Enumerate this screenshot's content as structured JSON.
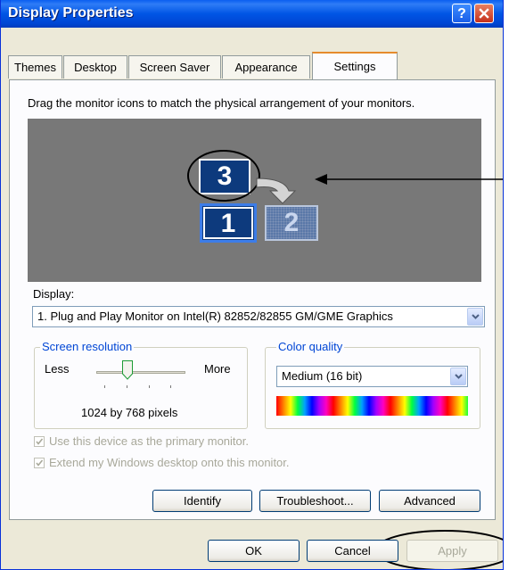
{
  "window": {
    "title": "Display Properties"
  },
  "tabs": [
    {
      "label": "Themes"
    },
    {
      "label": "Desktop"
    },
    {
      "label": "Screen Saver"
    },
    {
      "label": "Appearance"
    },
    {
      "label": "Settings"
    }
  ],
  "active_tab": "Settings",
  "settings": {
    "instruction": "Drag the monitor icons to match the physical arrangement of your monitors.",
    "monitors": [
      {
        "number": "3"
      },
      {
        "number": "1"
      },
      {
        "number": "2"
      }
    ],
    "display_label": "Display:",
    "display_value": "1. Plug and Play Monitor on Intel(R) 82852/82855 GM/GME Graphics",
    "resolution": {
      "group_label": "Screen resolution",
      "less": "Less",
      "more": "More",
      "value_text": "1024 by 768 pixels"
    },
    "color_quality": {
      "group_label": "Color quality",
      "value": "Medium (16 bit)"
    },
    "checkbox_primary": {
      "label": "Use this device as the primary monitor.",
      "checked": true
    },
    "checkbox_extend": {
      "label": "Extend my Windows desktop onto this monitor.",
      "checked": true
    },
    "buttons": {
      "identify": "Identify",
      "troubleshoot": "Troubleshoot...",
      "advanced": "Advanced"
    }
  },
  "footer": {
    "ok": "OK",
    "cancel": "Cancel",
    "apply": "Apply"
  },
  "colors": {
    "title_bar": "#0055e5",
    "preview_bg": "#787878",
    "monitor_active": "#0d3a7d",
    "tab_highlight": "#e68b2c"
  }
}
